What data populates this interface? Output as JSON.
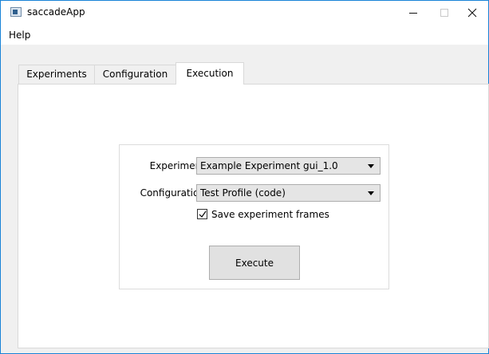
{
  "window": {
    "title": "saccadeApp"
  },
  "menu": {
    "items": [
      "Help"
    ]
  },
  "tabs": [
    {
      "label": "Experiments",
      "active": false
    },
    {
      "label": "Configuration",
      "active": false
    },
    {
      "label": "Execution",
      "active": true
    }
  ],
  "execution": {
    "experiment_label": "Experiment:",
    "experiment_value": "Example Experiment gui_1.0",
    "configuration_label": "Configuration:",
    "configuration_value": "Test Profile (code)",
    "save_frames_label": "Save experiment frames",
    "save_frames_checked": true,
    "execute_label": "Execute"
  },
  "colors": {
    "accent_border": "#1883d7",
    "panel_bg": "#ffffff",
    "window_bg": "#f0f0f0"
  },
  "icons": [
    "app-icon",
    "minimize-icon",
    "maximize-icon",
    "close-icon",
    "dropdown-arrow-icon",
    "checkmark-icon"
  ]
}
